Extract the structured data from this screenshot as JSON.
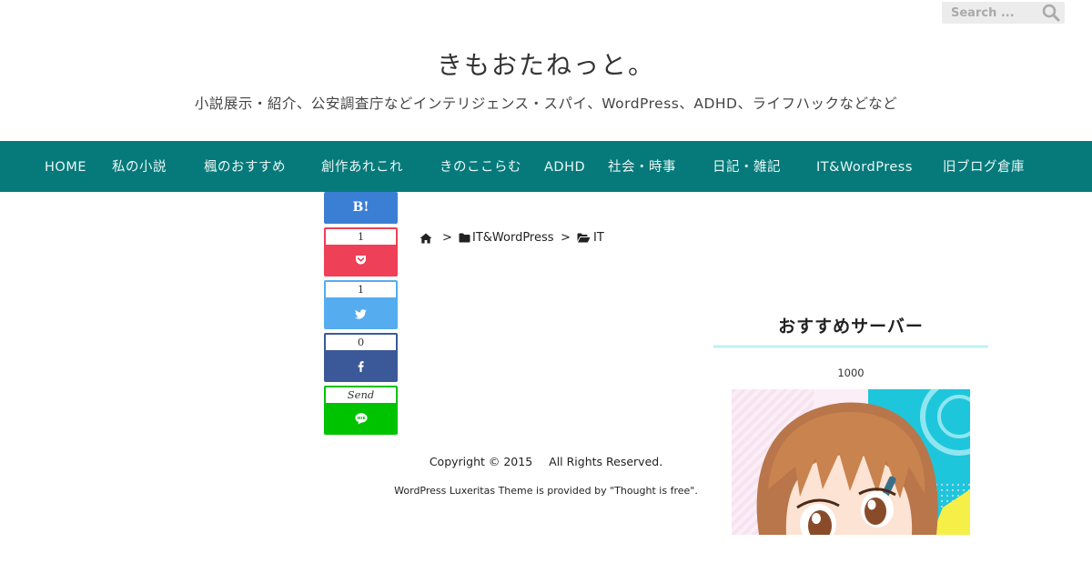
{
  "search": {
    "placeholder": "Search ..."
  },
  "site": {
    "title": "きもおたねっと。",
    "description": "小説展示・紹介、公安調査庁などインテリジェンス・スパイ、WordPress、ADHD、ライフハックなどなど"
  },
  "nav": {
    "items": [
      {
        "label": "HOME"
      },
      {
        "label": "私の小説"
      },
      {
        "label": "楓のおすすめ"
      },
      {
        "label": "創作あれこれ"
      },
      {
        "label": "きのここらむ"
      },
      {
        "label": "ADHD"
      },
      {
        "label": "社会・時事"
      },
      {
        "label": "日記・雑記"
      },
      {
        "label": "IT&WordPress"
      },
      {
        "label": "旧ブログ倉庫"
      }
    ]
  },
  "share": {
    "hatena_label": "B!",
    "pocket_count": "1",
    "twitter_count": "1",
    "facebook_count": "0",
    "line_label": "Send"
  },
  "breadcrumb": {
    "separator": ">",
    "items": [
      {
        "label": "IT&WordPress"
      },
      {
        "label": "IT"
      }
    ]
  },
  "sidebar": {
    "widget_title": "おすすめサーバー",
    "widget_count": "1000"
  },
  "footer": {
    "copyright": "Copyright © 2015",
    "rights": "All Rights Reserved.",
    "credit": "WordPress Luxeritas Theme is provided by \"Thought is free\"."
  },
  "colors": {
    "nav_background": "#067a7a",
    "hatena": "#3b7fd4",
    "pocket": "#ee4056",
    "twitter": "#55acee",
    "facebook": "#3b5998",
    "line": "#00c300"
  }
}
